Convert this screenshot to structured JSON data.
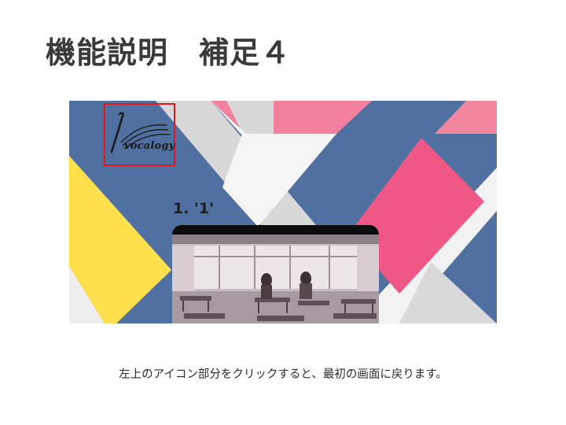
{
  "slide": {
    "title": "機能説明　補足４",
    "caption": "左上のアイコン部分をクリックすると、最初の画面に戻ります。"
  },
  "screenshot": {
    "logo_text": "vocalogy",
    "track_title": "1. '1'",
    "colors": {
      "navy": "#5070a2",
      "pink": "#f06d90",
      "light_pink": "#f3849f",
      "yellow": "#ffe04c",
      "light_gray": "#d9d9d9",
      "white": "#f2f2f2",
      "highlight_border": "#e01818"
    }
  }
}
